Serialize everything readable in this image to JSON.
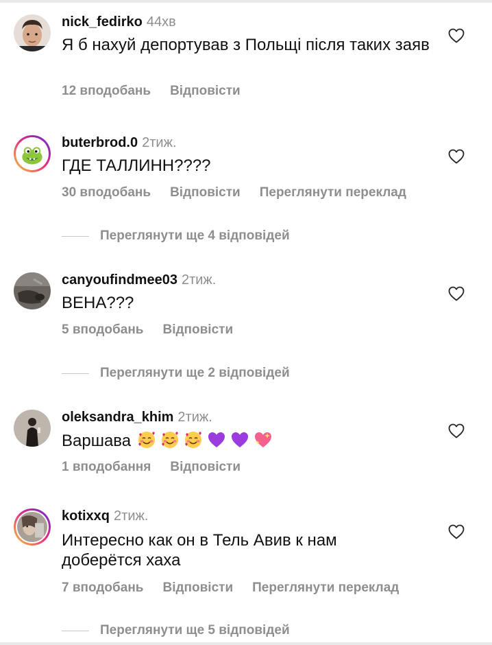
{
  "comments": [
    {
      "username": "nick_fedirko",
      "time": "44хв",
      "text": "Я б нахуй депортував з Польщі після таких заяв",
      "likes": "12 вподобань",
      "reply": "Відповісти"
    },
    {
      "username": "buterbrod.0",
      "time": "2тиж.",
      "text": "ГДЕ ТАЛЛИНН????",
      "likes": "30 вподобань",
      "reply": "Відповісти",
      "translate": "Переглянути переклад",
      "view_replies": "Переглянути ще 4 відповідей"
    },
    {
      "username": "canyoufindmee03",
      "time": "2тиж.",
      "text": "ВЕНА???",
      "likes": "5 вподобань",
      "reply": "Відповісти",
      "view_replies": "Переглянути ще 2 відповідей"
    },
    {
      "username": "oleksandra_khim",
      "time": "2тиж.",
      "text": "Варшава",
      "emojis": [
        "smiling-face-with-hearts-emoji",
        "smiling-face-with-hearts-emoji",
        "smiling-face-with-hearts-emoji",
        "purple-heart-emoji",
        "purple-heart-emoji",
        "sparkling-heart-emoji"
      ],
      "likes": "1 вподобання",
      "reply": "Відповісти"
    },
    {
      "username": "kotixxq",
      "time": "2тиж.",
      "text": "Интересно как он в Тель Авив к нам доберётся хаха",
      "likes": "7 вподобань",
      "reply": "Відповісти",
      "translate": "Переглянути переклад",
      "view_replies": "Переглянути ще 5 відповідей"
    }
  ],
  "icons": {
    "like": "heart-outline-icon"
  },
  "colors": {
    "text": "#111111",
    "muted": "#8e8e8e",
    "divider": "#c7c7c7",
    "story_ring_start": "#f9ce34",
    "story_ring_mid": "#ee2a7b",
    "story_ring_end": "#6228d7"
  }
}
